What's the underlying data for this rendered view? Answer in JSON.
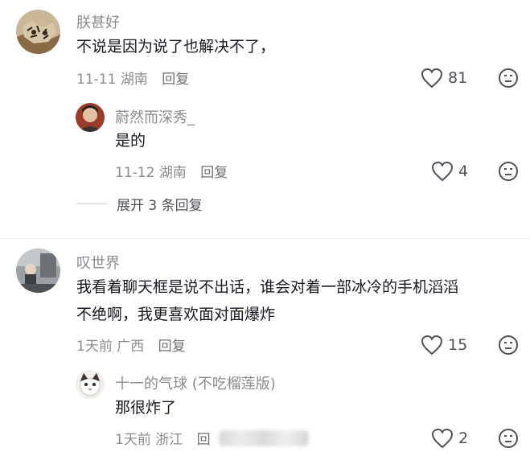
{
  "comments": [
    {
      "username": "朕甚好",
      "text": "不说是因为说了也解决不了，",
      "date": "11-11",
      "location": "湖南",
      "reply_label": "回复",
      "likes": "81",
      "replies": [
        {
          "username": "蔚然而深秀_",
          "text": "是的",
          "date": "11-12",
          "location": "湖南",
          "reply_label": "回复",
          "likes": "4"
        }
      ],
      "expand_label": "展开 3 条回复"
    },
    {
      "username": "叹世界",
      "text_line1": "我看着聊天框是说不出话，谁会对着一部冰冷的手机滔滔",
      "text_line2": "不绝啊，我更喜欢面对面爆炸",
      "date": "1天前",
      "location": "广西",
      "reply_label": "回复",
      "likes": "15",
      "replies": [
        {
          "username": "十一的气球 (不吃榴莲版)",
          "text": "那很炸了",
          "date": "1天前",
          "location": "浙江",
          "reply_label": "回",
          "likes": "2"
        }
      ]
    }
  ],
  "icons": {
    "like": "heart-outline-icon",
    "dislike": "sad-face-icon"
  },
  "colors": {
    "text": "#161823",
    "meta": "#8a8b91",
    "icon": "#4f5058"
  }
}
